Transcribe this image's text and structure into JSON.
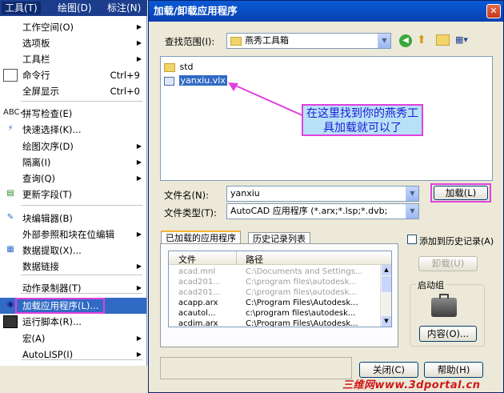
{
  "menubar": {
    "items": [
      "工具(T)",
      "绘图(D)",
      "标注(N)"
    ]
  },
  "menu": {
    "items": [
      {
        "label": "工作空间(O)",
        "shortcut": "",
        "submenu": true,
        "icon": ""
      },
      {
        "label": "选项板",
        "shortcut": "",
        "submenu": true,
        "icon": ""
      },
      {
        "label": "工具栏",
        "shortcut": "",
        "submenu": true,
        "icon": ""
      },
      {
        "label": "命令行",
        "shortcut": "Ctrl+9",
        "submenu": false,
        "icon": "command-line-icon"
      },
      {
        "label": "全屏显示",
        "shortcut": "Ctrl+0",
        "submenu": false,
        "icon": ""
      },
      {
        "label": "拼写检查(E)",
        "shortcut": "",
        "submenu": false,
        "icon": "spell-check-icon"
      },
      {
        "label": "快速选择(K)...",
        "shortcut": "",
        "submenu": false,
        "icon": "quick-select-icon"
      },
      {
        "label": "绘图次序(D)",
        "shortcut": "",
        "submenu": true,
        "icon": ""
      },
      {
        "label": "隔离(I)",
        "shortcut": "",
        "submenu": true,
        "icon": ""
      },
      {
        "label": "查询(Q)",
        "shortcut": "",
        "submenu": true,
        "icon": ""
      },
      {
        "label": "更新字段(T)",
        "shortcut": "",
        "submenu": false,
        "icon": "update-field-icon"
      },
      {
        "label": "块编辑器(B)",
        "shortcut": "",
        "submenu": false,
        "icon": "block-editor-icon"
      },
      {
        "label": "外部参照和块在位编辑",
        "shortcut": "",
        "submenu": true,
        "icon": ""
      },
      {
        "label": "数据提取(X)...",
        "shortcut": "",
        "submenu": false,
        "icon": "data-extract-icon"
      },
      {
        "label": "数据链接",
        "shortcut": "",
        "submenu": true,
        "icon": ""
      },
      {
        "label": "动作录制器(T)",
        "shortcut": "",
        "submenu": true,
        "icon": ""
      },
      {
        "label": "加载应用程序(L)...",
        "shortcut": "",
        "submenu": false,
        "icon": "load-app-icon"
      },
      {
        "label": "运行脚本(R)...",
        "shortcut": "",
        "submenu": false,
        "icon": "run-script-icon"
      },
      {
        "label": "宏(A)",
        "shortcut": "",
        "submenu": true,
        "icon": ""
      },
      {
        "label": "AutoLISP(I)",
        "shortcut": "",
        "submenu": true,
        "icon": ""
      }
    ]
  },
  "dialog": {
    "title": "加载/卸载应用程序",
    "lookin_label": "查找范围(I):",
    "lookin_value": "燕秀工具箱",
    "files": [
      "std",
      "yanxiu.vlx"
    ],
    "callout": "在这里找到你的燕秀工具加载就可以了",
    "filename_label": "文件名(N):",
    "filename_value": "yanxiu",
    "filetype_label": "文件类型(T):",
    "filetype_value": "AutoCAD 应用程序 (*.arx;*.lsp;*.dvb;",
    "load_button": "加载(L)",
    "tabs": [
      "已加载的应用程序",
      "历史记录列表"
    ],
    "list_headers": [
      "文件",
      "路径"
    ],
    "list_rows": [
      {
        "file": "acad.mnl",
        "path": "C:\\Documents and Settings...",
        "dim": true
      },
      {
        "file": "acad201...",
        "path": "C:\\program files\\autodesk...",
        "dim": true
      },
      {
        "file": "acad201...",
        "path": "C:\\program files\\autodesk...",
        "dim": true
      },
      {
        "file": "acapp.arx",
        "path": "C:\\Program Files\\Autodesk...",
        "dim": false
      },
      {
        "file": "acautol...",
        "path": "c:\\program files\\autodesk...",
        "dim": false
      },
      {
        "file": "acdim.arx",
        "path": "C:\\Program Files\\Autodesk...",
        "dim": false
      }
    ],
    "history_checkbox": "添加到历史记录(A)",
    "unload_button": "卸载(U)",
    "startup_group": "启动组",
    "contents_button": "内容(O)...",
    "close_button": "关闭(C)",
    "help_button": "帮助(H)",
    "watermark": "三维网www.3dportal.cn"
  },
  "colors": {
    "titlebar": "#0a5ad6",
    "menubar": "#1c3d8c",
    "highlight": "#316ac5",
    "annotation": "#e040e0"
  }
}
